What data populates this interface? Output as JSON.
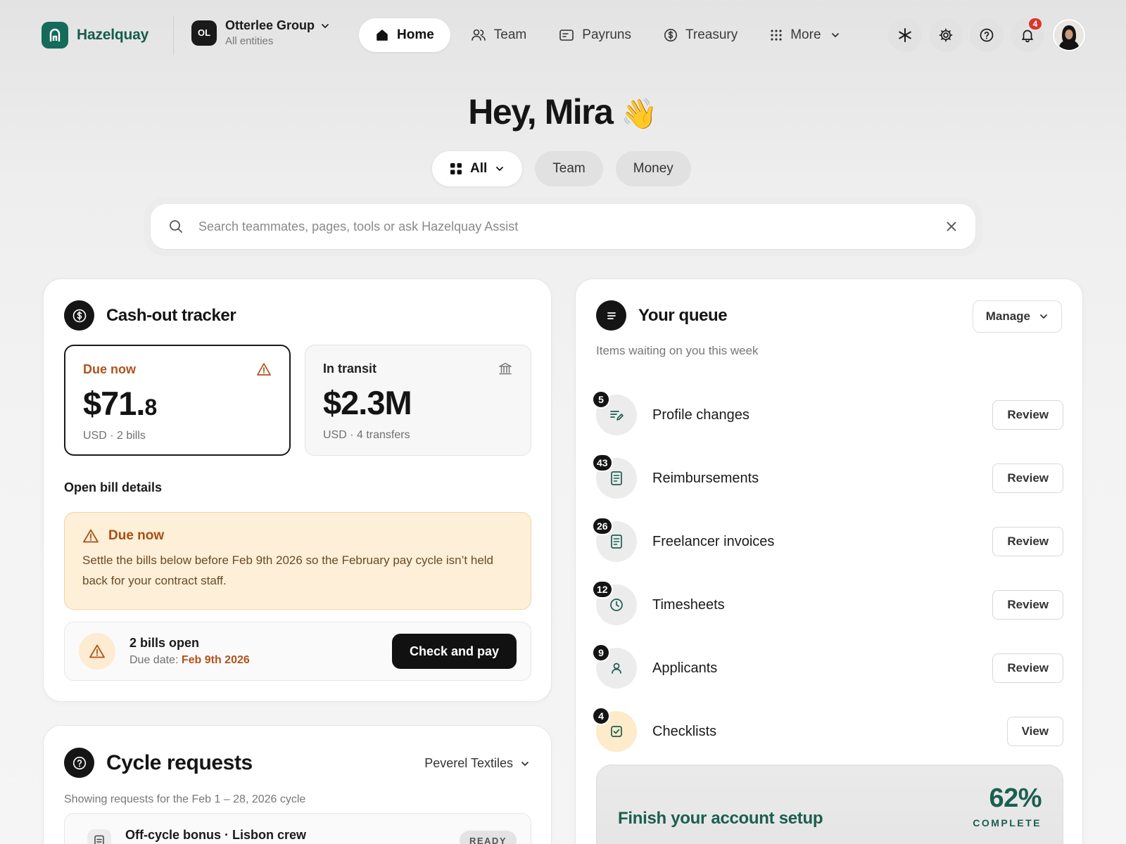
{
  "brand": {
    "name": "Hazelquay"
  },
  "entity": {
    "initials": "OL",
    "name": "Otterlee Group",
    "sub": "All entities"
  },
  "nav": {
    "items": [
      {
        "label": "Home",
        "icon": "home-icon",
        "active": true
      },
      {
        "label": "Team",
        "icon": "users-icon"
      },
      {
        "label": "Payruns",
        "icon": "payruns-icon"
      },
      {
        "label": "Treasury",
        "icon": "dollar-circle-icon"
      },
      {
        "label": "More",
        "icon": "grid-dots-icon"
      }
    ],
    "notifications_count": "4"
  },
  "greeting": {
    "text": "Hey, Mira",
    "emoji": "👋"
  },
  "filters": [
    {
      "label": "All",
      "active": true
    },
    {
      "label": "Team"
    },
    {
      "label": "Money"
    }
  ],
  "search": {
    "placeholder": "Search teammates, pages, tools or ask Hazelquay Assist",
    "value": ""
  },
  "cashout": {
    "title": "Cash-out tracker",
    "due": {
      "label": "Due now",
      "amount_main": "$71.",
      "amount_small": "8",
      "meta": "USD · 2 bills"
    },
    "transit": {
      "label": "In transit",
      "amount": "$2.3M",
      "meta": "USD · 4 transfers"
    },
    "section_label": "Open bill details",
    "alert": {
      "title": "Due now",
      "body": "Settle the bills below before Feb 9th 2026 so the February pay cycle isn’t held back for your contract staff."
    },
    "bills": {
      "title": "2 bills open",
      "due_prefix": "Due date: ",
      "due_date": "Feb 9th 2026",
      "action": "Check and pay"
    }
  },
  "cycle": {
    "title": "Cycle requests",
    "filter": "Peverel Textiles",
    "subtitle": "Showing requests for the Feb 1 – 28, 2026 cycle",
    "item": {
      "title": "Off-cycle bonus · Lisbon crew",
      "status": "READY"
    }
  },
  "queue": {
    "title": "Your queue",
    "manage_label": "Manage",
    "subtitle": "Items waiting on you this week",
    "items": [
      {
        "count": "5",
        "label": "Profile changes",
        "action": "Review",
        "icon": "profile-edit-icon"
      },
      {
        "count": "43",
        "label": "Reimbursements",
        "action": "Review",
        "icon": "receipt-icon"
      },
      {
        "count": "26",
        "label": "Freelancer invoices",
        "action": "Review",
        "icon": "invoice-icon"
      },
      {
        "count": "12",
        "label": "Timesheets",
        "action": "Review",
        "icon": "clock-icon"
      },
      {
        "count": "9",
        "label": "Applicants",
        "action": "Review",
        "icon": "person-icon"
      },
      {
        "count": "4",
        "label": "Checklists",
        "action": "View",
        "icon": "checkbox-icon"
      }
    ],
    "setup": {
      "title": "Finish your account setup",
      "percent": "62%",
      "complete_label": "COMPLETE",
      "progress": 0.62
    }
  },
  "colors": {
    "brand": "#146b5a",
    "accent_warn": "#b0531a",
    "badge": "#d9362b"
  }
}
